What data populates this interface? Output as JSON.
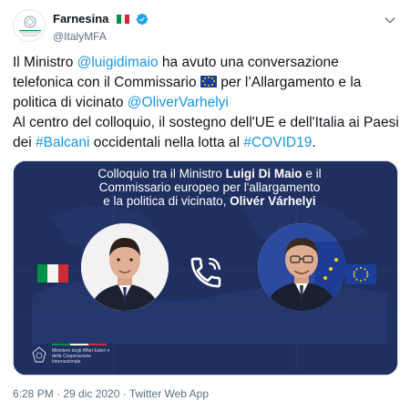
{
  "account": {
    "display_name": "Farnesina",
    "handle": "@ItalyMFA",
    "avatar_caption": "MINISTERO DEGLI AFFARI ESTERI E DELLA COOPERAZIONE INTERNAZIONALE"
  },
  "tweet": {
    "t1": "Il Ministro ",
    "mention1": "@luigidimaio",
    "t2": " ha avuto una conversazione telefonica con il Commissario ",
    "t3": " per l’Allargamento e la politica di vicinato ",
    "mention2": "@OliverVarhelyi",
    "t4": "Al centro del colloquio, il sostegno dell'UE e dell'Italia ai Paesi dei ",
    "hashtag1": "#Balcani",
    "t5": " occidentali nella lotta al ",
    "hashtag2": "#COVID19",
    "t6": "."
  },
  "card": {
    "line1_a": "Colloquio tra il Ministro ",
    "line1_b": "Luigi Di Maio",
    "line1_c": " e il",
    "line2": "Commissario europeo per l'allargamento",
    "line3_a": "e la politica di vicinato, ",
    "line3_b": "Olivér Várhelyi",
    "logo_text": "Ministero degli Affari Esteri e della Cooperazione Internazionale"
  },
  "meta": {
    "line": "6:28 PM · 29 dic 2020 · Twitter Web App"
  },
  "colors": {
    "link": "#1b95e0",
    "card_bg": "#1f2f5f",
    "verified": "#1da1f2",
    "italy_green": "#009246",
    "italy_red": "#ce2b37",
    "eu_blue": "#1a3f9a",
    "eu_gold": "#f6d31b"
  },
  "icons": [
    "italy-flag-icon",
    "verified-badge-icon",
    "chevron-down-icon",
    "eu-flag-icon",
    "phone-icon"
  ]
}
